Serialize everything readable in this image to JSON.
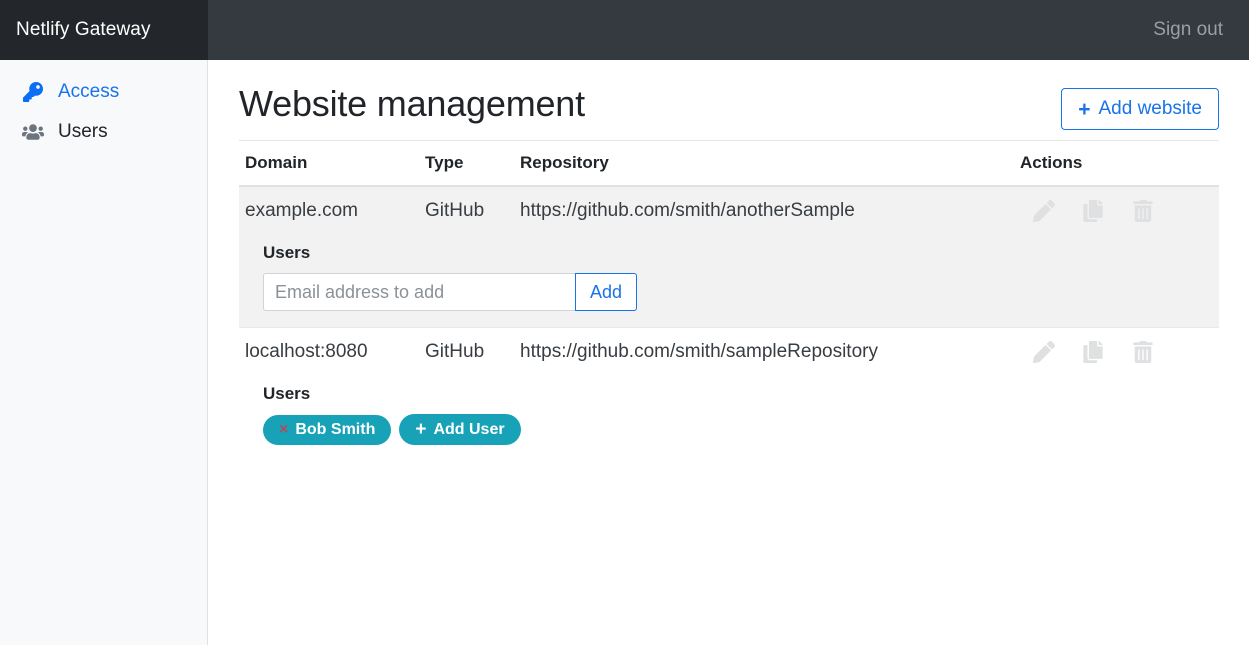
{
  "navbar": {
    "brand": "Netlify Gateway",
    "signout_label": "Sign out"
  },
  "sidebar": {
    "items": [
      {
        "label": "Access",
        "icon": "key-icon",
        "active": true
      },
      {
        "label": "Users",
        "icon": "users-group-icon",
        "active": false
      }
    ]
  },
  "page": {
    "title": "Website management",
    "add_website_label": "Add website",
    "add_website_plus": "+"
  },
  "table": {
    "headers": {
      "domain": "Domain",
      "type": "Type",
      "repository": "Repository",
      "actions": "Actions"
    },
    "action_icons": [
      "pencil-icon",
      "copy-icon",
      "trash-icon"
    ],
    "rows": [
      {
        "domain": "example.com",
        "type": "GitHub",
        "repository": "https://github.com/smith/anotherSample",
        "users_heading": "Users",
        "users_mode": "input",
        "email_placeholder": "Email address to add",
        "email_value": "",
        "add_label": "Add",
        "badges": []
      },
      {
        "domain": "localhost:8080",
        "type": "GitHub",
        "repository": "https://github.com/smith/sampleRepository",
        "users_heading": "Users",
        "users_mode": "badges",
        "email_placeholder": "",
        "email_value": "",
        "add_label": "",
        "badges": [
          {
            "label": "Bob Smith",
            "glyph": "×",
            "kind": "remove"
          },
          {
            "label": "Add User",
            "glyph": "+",
            "kind": "add"
          }
        ]
      }
    ]
  },
  "colors": {
    "navbar": "#343a40",
    "brand_box": "#23272b",
    "accent_blue": "#1a73e8",
    "badge_teal": "#17a2b8",
    "badge_x_red": "#b5485d",
    "row_stripe": "#f2f2f2",
    "sidebar_bg": "#f8f9fa"
  }
}
